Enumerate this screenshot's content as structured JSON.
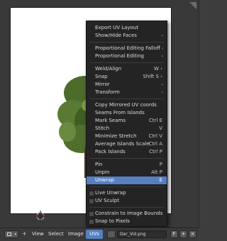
{
  "menu": {
    "items": [
      {
        "label": "Export UV Layout"
      },
      {
        "label": "Show/Hide Faces",
        "arrow": "›"
      },
      {
        "separator": true
      },
      {
        "label": "Proportional Editing Falloff",
        "arrow": "›"
      },
      {
        "label": "Proportional Editing",
        "arrow": "›"
      },
      {
        "separator": true
      },
      {
        "label": "Weld/Align",
        "shortcut": "W ›"
      },
      {
        "label": "Snap",
        "shortcut": "Shift S ›"
      },
      {
        "label": "Mirror",
        "arrow": "›"
      },
      {
        "label": "Transform",
        "arrow": "›"
      },
      {
        "separator": true
      },
      {
        "label": "Copy Mirrored UV coords"
      },
      {
        "label": "Seams From Islands"
      },
      {
        "label": "Mark Seams",
        "shortcut": "Ctrl E"
      },
      {
        "label": "Stitch",
        "shortcut": "V"
      },
      {
        "label": "Minimize Stretch",
        "shortcut": "Ctrl V"
      },
      {
        "label": "Average Islands Scale",
        "shortcut": "Ctrl A"
      },
      {
        "label": "Pack Islands",
        "shortcut": "Ctrl P"
      },
      {
        "separator": true
      },
      {
        "label": "Pin",
        "shortcut": "P"
      },
      {
        "label": "Unpin",
        "shortcut": "Alt P"
      },
      {
        "label": "Unwrap",
        "shortcut": "E",
        "highlighted": true
      },
      {
        "separator": true
      },
      {
        "label": "Live Unwrap",
        "check": true
      },
      {
        "label": "UV Sculpt",
        "check": true
      },
      {
        "separator": true
      },
      {
        "label": "Constrain to Image Bounds",
        "check": true
      },
      {
        "label": "Snap to Pixels",
        "check": true
      }
    ]
  },
  "header": {
    "plus": "+",
    "view": "View",
    "select": "Select",
    "image": "Image",
    "uvs": "UVs",
    "filename": "Der_Vid.png",
    "f_label": "F",
    "plus_btn": "+",
    "x_btn": "×"
  },
  "colors": {
    "accent": "#5680c2",
    "menu_bg": "#242424",
    "viewport_bg": "#393939"
  }
}
